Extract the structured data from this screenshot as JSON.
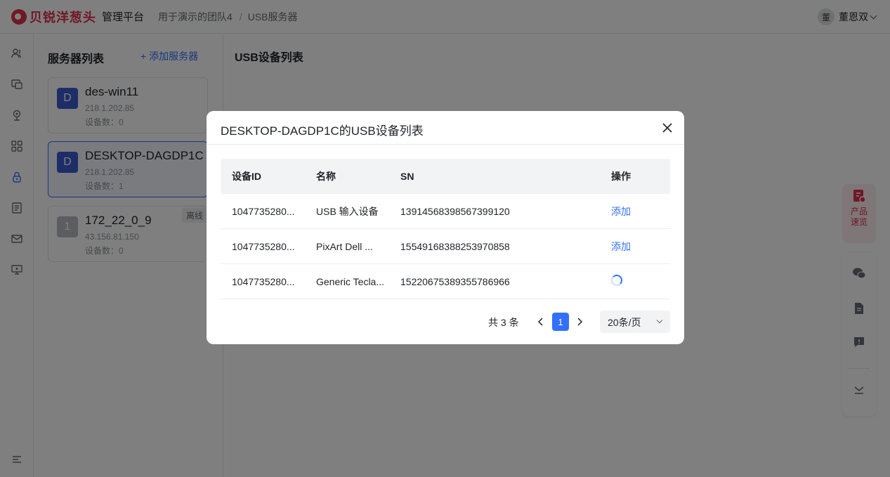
{
  "app": {
    "logo_text": "贝锐洋葱头",
    "platform": "管理平台",
    "breadcrumb": [
      "用于演示的团队4",
      "USB服务器"
    ],
    "user": {
      "avatar": "董",
      "name": "董恩双"
    }
  },
  "sidebar_icons": [
    "users-icon",
    "devices-icon",
    "camera-icon",
    "apps-icon",
    "usb-lock-icon",
    "document-icon",
    "mail-icon",
    "remote-icon",
    "menu-icon"
  ],
  "server_panel": {
    "title": "服务器列表",
    "add_label": "添加服务器",
    "servers": [
      {
        "avatar": "D",
        "name": "des-win11",
        "ip": "218.1.202.85",
        "count": "设备数：0"
      },
      {
        "avatar": "D",
        "name": "DESKTOP-DAGDP1C",
        "ip": "218.1.202.85",
        "count": "设备数：1"
      },
      {
        "avatar": "1",
        "name": "172_22_0_9",
        "ip": "43.156.81.150",
        "count": "设备数：0",
        "badge": "离线"
      }
    ]
  },
  "main": {
    "title": "USB设备列表"
  },
  "float_product": {
    "label": "产品速览"
  },
  "modal": {
    "title": "DESKTOP-DAGDP1C的USB设备列表",
    "columns": [
      "设备ID",
      "名称",
      "SN",
      "操作"
    ],
    "rows": [
      {
        "id": "1047735280...",
        "name": "USB 输入设备",
        "sn": "13914568398567399120",
        "action": "添加"
      },
      {
        "id": "1047735280...",
        "name": "PixArt Dell ...",
        "sn": "15549168388253970858",
        "action": "添加"
      },
      {
        "id": "1047735280...",
        "name": "Generic Tecla...",
        "sn": "15220675389355786966",
        "action": ""
      }
    ],
    "pagination": {
      "total": "共 3 条",
      "page": "1",
      "page_size": "20条/页"
    }
  },
  "colors": {
    "primary": "#3370ff",
    "brand": "#e0314c",
    "mask": "rgba(0,0,0,0.5)"
  }
}
